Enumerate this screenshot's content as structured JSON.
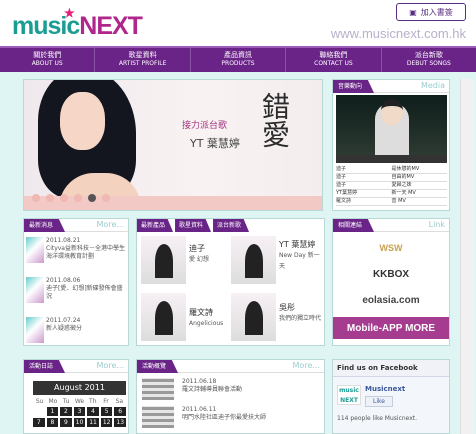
{
  "header": {
    "logo_left": "music",
    "logo_right": "NEXT",
    "bookmark": "加入書簽",
    "url": "www.musicnext.com.hk"
  },
  "nav": [
    {
      "zh": "關於我們",
      "en": "ABOUT US"
    },
    {
      "zh": "歌星資料",
      "en": "ARTIST PROFILE"
    },
    {
      "zh": "產品資訊",
      "en": "PRODUCTS"
    },
    {
      "zh": "聯絡我們",
      "en": "CONTACT US"
    },
    {
      "zh": "派台新歌",
      "en": "DEBUT SONGS"
    }
  ],
  "banner": {
    "subtitle": "接力派台歌",
    "artist": "YT 葉慧婷",
    "song": "錯愛"
  },
  "video": {
    "title": "音樂動向",
    "tab": "Media",
    "rows": [
      [
        "迪子",
        "是休憩的MV"
      ],
      [
        "迪子",
        "自由的MV"
      ],
      [
        "迪子",
        "愛歸之妹"
      ],
      [
        "YT葉慧婷",
        "新一天 MV"
      ],
      [
        "羅文詩",
        "音 MV"
      ]
    ]
  },
  "news": {
    "title": "最新消息",
    "more": "More...",
    "items": [
      {
        "date": "2011.08.21",
        "text": "Cityva益新科技－全港中學生海洋環境教育計劃"
      },
      {
        "date": "2011.08.06",
        "text": "迪子[愛．幻想]新碟發佈會盛況"
      },
      {
        "date": "2011.07.24",
        "text": "新人疑惑徵分"
      }
    ]
  },
  "products": {
    "tabs": [
      "最新產品",
      "歌星資料",
      "派台新歌"
    ],
    "items": [
      {
        "name": "迪子",
        "sub": "愛 幻想"
      },
      {
        "name": "YT 葉慧婷",
        "sub": "New Day 新一天"
      },
      {
        "name": "羅文詩",
        "sub": "Angelicious"
      },
      {
        "name": "吳彤",
        "sub": "我們的獨立時代"
      }
    ]
  },
  "links": {
    "title": "相關連結",
    "tab": "Link",
    "buttons": [
      "WSW",
      "KKBOX",
      "eolasia.com",
      "Mobile-APP MORE"
    ]
  },
  "calendar": {
    "title": "活動日誌",
    "more": "More...",
    "month": "August 2011",
    "days": [
      "Su",
      "Mo",
      "Tu",
      "We",
      "Th",
      "Fr",
      "Sa"
    ],
    "dates": [
      "",
      "1",
      "2",
      "3",
      "4",
      "5",
      "6",
      "7",
      "8",
      "9",
      "10",
      "11",
      "12",
      "13",
      "14",
      "15",
      "16",
      "17",
      "18",
      "19",
      "20"
    ]
  },
  "events": {
    "title": "活動概覽",
    "more": "More...",
    "items": [
      {
        "date": "2011.06.18",
        "text": "羅文詩輔導員聯會活動"
      },
      {
        "date": "2011.06.11",
        "text": "明門水陸社區迪子你最愛扶大師"
      }
    ]
  },
  "facebook": {
    "title": "Find us on Facebook",
    "page": "Musicnext",
    "like": "Like",
    "count": "114 people like Musicnext."
  }
}
